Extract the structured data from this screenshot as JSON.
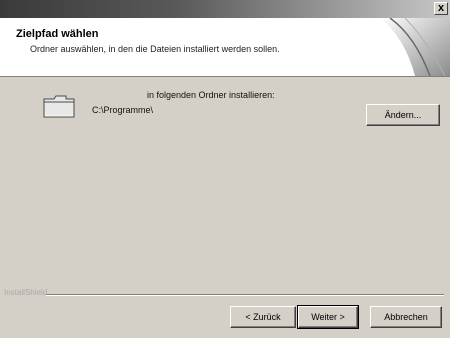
{
  "window": {
    "close_symbol": "x"
  },
  "header": {
    "title": "Zielpfad wählen",
    "subtitle": "Ordner auswählen, in den die Dateien installiert werden sollen."
  },
  "main": {
    "folder_icon": "folder-icon",
    "install_label": "in folgenden Ordner installieren:",
    "install_path": "C:\\Programme\\",
    "change_button": "Ändern..."
  },
  "footer": {
    "brand_label": "InstallShield",
    "back_button": "< Zurück",
    "next_button": "Weiter >",
    "cancel_button": "Abbrechen"
  }
}
